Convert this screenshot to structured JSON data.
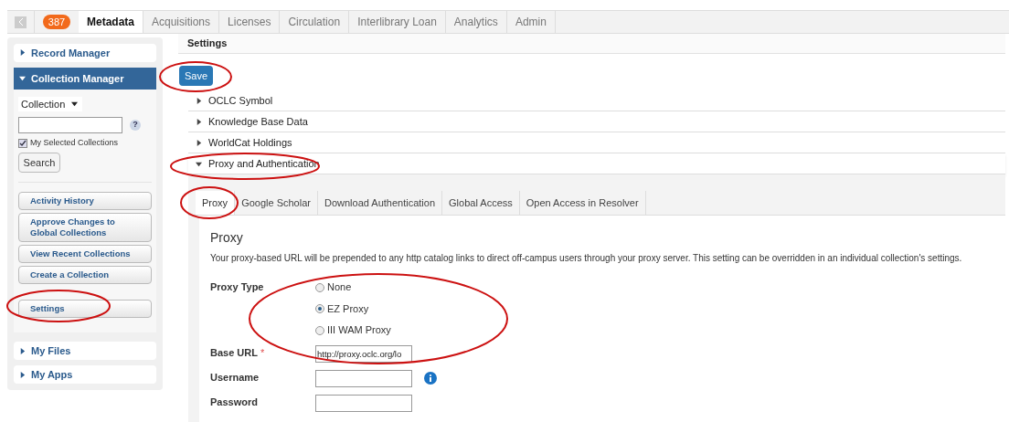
{
  "nav": {
    "badge": "387",
    "tabs": [
      {
        "label": "Metadata",
        "selected": true
      },
      {
        "label": "Acquisitions",
        "selected": false
      },
      {
        "label": "Licenses",
        "selected": false
      },
      {
        "label": "Circulation",
        "selected": false
      },
      {
        "label": "Interlibrary Loan",
        "selected": false
      },
      {
        "label": "Analytics",
        "selected": false
      },
      {
        "label": "Admin",
        "selected": false
      }
    ]
  },
  "sidebar": {
    "sections": [
      {
        "label": "Record Manager",
        "expanded": false
      },
      {
        "label": "Collection Manager",
        "expanded": true,
        "select": "Collection",
        "help": "?",
        "checkbox": {
          "label": "My Selected Collections",
          "checked": true
        },
        "search_button": "Search",
        "buttons": [
          "Activity History",
          "Approve Changes to Global Collections",
          "View Recent Collections",
          "Create a Collection",
          "Settings"
        ]
      },
      {
        "label": "My Files",
        "expanded": false
      },
      {
        "label": "My Apps",
        "expanded": false
      }
    ]
  },
  "main": {
    "title": "Settings",
    "save_button": "Save",
    "accordion": [
      {
        "label": "OCLC Symbol",
        "expanded": false
      },
      {
        "label": "Knowledge Base Data",
        "expanded": false
      },
      {
        "label": "WorldCat Holdings",
        "expanded": false
      },
      {
        "label": "Proxy and Authentication",
        "expanded": true
      }
    ],
    "tabs": [
      {
        "label": "Proxy",
        "selected": true
      },
      {
        "label": "Google Scholar",
        "selected": false
      },
      {
        "label": "Download Authentication",
        "selected": false
      },
      {
        "label": "Global Access",
        "selected": false
      },
      {
        "label": "Open Access in Resolver",
        "selected": false
      }
    ],
    "proxy": {
      "heading": "Proxy",
      "description": "Your proxy-based URL will be prepended to any http catalog links to direct off-campus users through your proxy server. This setting can be overridden in an individual collection's settings.",
      "fields": [
        {
          "kind": "radio",
          "label": "Proxy Type",
          "options": [
            {
              "label": "None",
              "selected": false
            },
            {
              "label": "EZ Proxy",
              "selected": true
            },
            {
              "label": "III WAM Proxy",
              "selected": false
            }
          ]
        },
        {
          "kind": "text",
          "label": "Base URL",
          "required_mark": "*",
          "value": "http://proxy.oclc.org/lo"
        },
        {
          "kind": "text",
          "label": "Username",
          "info": true
        },
        {
          "kind": "text",
          "label": "Password"
        }
      ]
    }
  }
}
